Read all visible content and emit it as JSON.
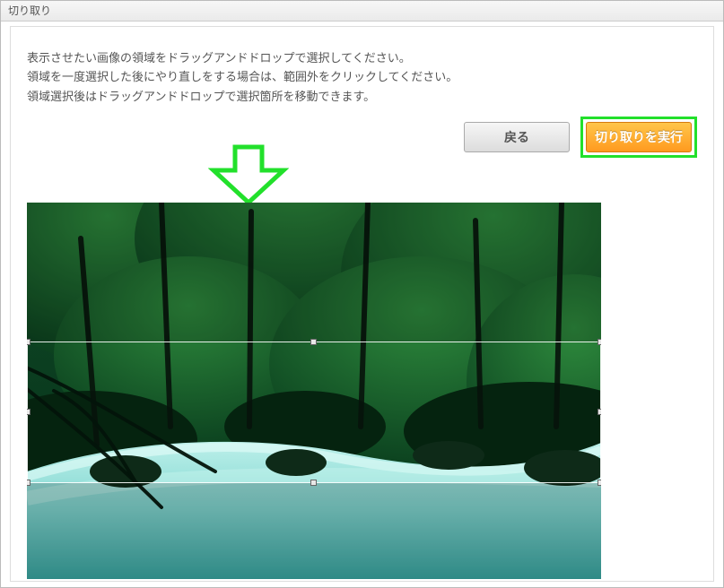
{
  "window": {
    "title": "切り取り"
  },
  "instructions": {
    "line1": "表示させたい画像の領域をドラッグアンドドロップで選択してください。",
    "line2": "領域を一度選択した後にやり直しをする場合は、範囲外をクリックしてください。",
    "line3": "領域選択後はドラッグアンドドロップで選択箇所を移動できます。"
  },
  "buttons": {
    "back": "戻る",
    "execute_crop": "切り取りを実行"
  },
  "annotation": {
    "arrow_color": "#22e02b",
    "highlight_color": "#22e02b"
  }
}
